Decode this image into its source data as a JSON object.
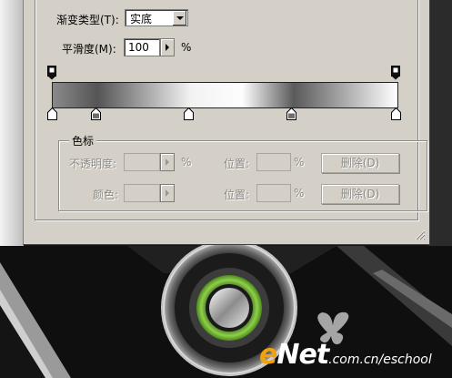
{
  "dialog": {
    "gradient_type": {
      "label": "渐变类型(T):",
      "value": "实底"
    },
    "smoothness": {
      "label": "平滑度(M):",
      "value": "100",
      "unit": "%"
    },
    "gradient_colors": [
      "#8a8a8a",
      "#555555",
      "#f2f2f2",
      "#fdfdfd",
      "#5a5a5a",
      "#ffffff"
    ],
    "color_stops": {
      "title": "色标",
      "opacity": {
        "label": "不透明度:",
        "value": "",
        "unit": "%"
      },
      "opacity_location": {
        "label": "位置:",
        "value": "",
        "unit": "%"
      },
      "opacity_delete": "删除(D)",
      "color": {
        "label": "颜色:"
      },
      "color_location": {
        "label": "位置:",
        "value": "",
        "unit": "%"
      },
      "color_delete": "删除(D)"
    }
  },
  "watermark": {
    "logo_e": "e",
    "logo_net": "Net",
    "url": ".com.cn/eschool"
  }
}
